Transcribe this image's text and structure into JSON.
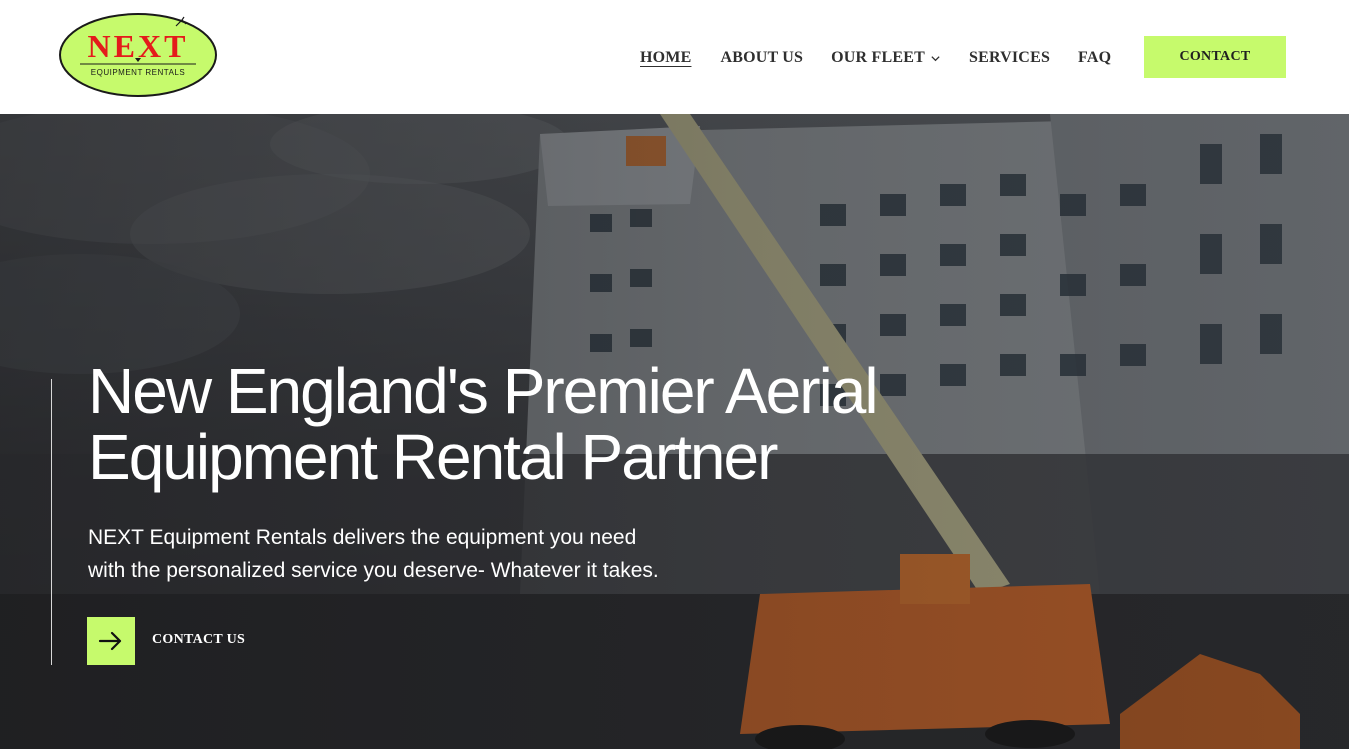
{
  "logo": {
    "brand": "NEXT",
    "tagline": "EQUIPMENT RENTALS"
  },
  "nav": {
    "items": [
      {
        "label": "HOME",
        "active": true
      },
      {
        "label": "ABOUT US"
      },
      {
        "label": "OUR FLEET",
        "has_dropdown": true
      },
      {
        "label": "SERVICES"
      },
      {
        "label": "FAQ"
      }
    ],
    "contact_label": "CONTACT"
  },
  "hero": {
    "headline_line1": "New England's Premier Aerial",
    "headline_line2": "Equipment Rental Partner",
    "subtext_line1": "NEXT Equipment Rentals delivers the equipment you need",
    "subtext_line2": "with the personalized service you deserve- Whatever it takes.",
    "cta_label": "CONTACT US"
  },
  "colors": {
    "accent": "#c6fa6c",
    "logo_fill": "#c6fa6c",
    "logo_text": "#e41b1b"
  },
  "icons": {
    "cta": "arrow-right-icon",
    "dropdown": "chevron-down-icon"
  }
}
